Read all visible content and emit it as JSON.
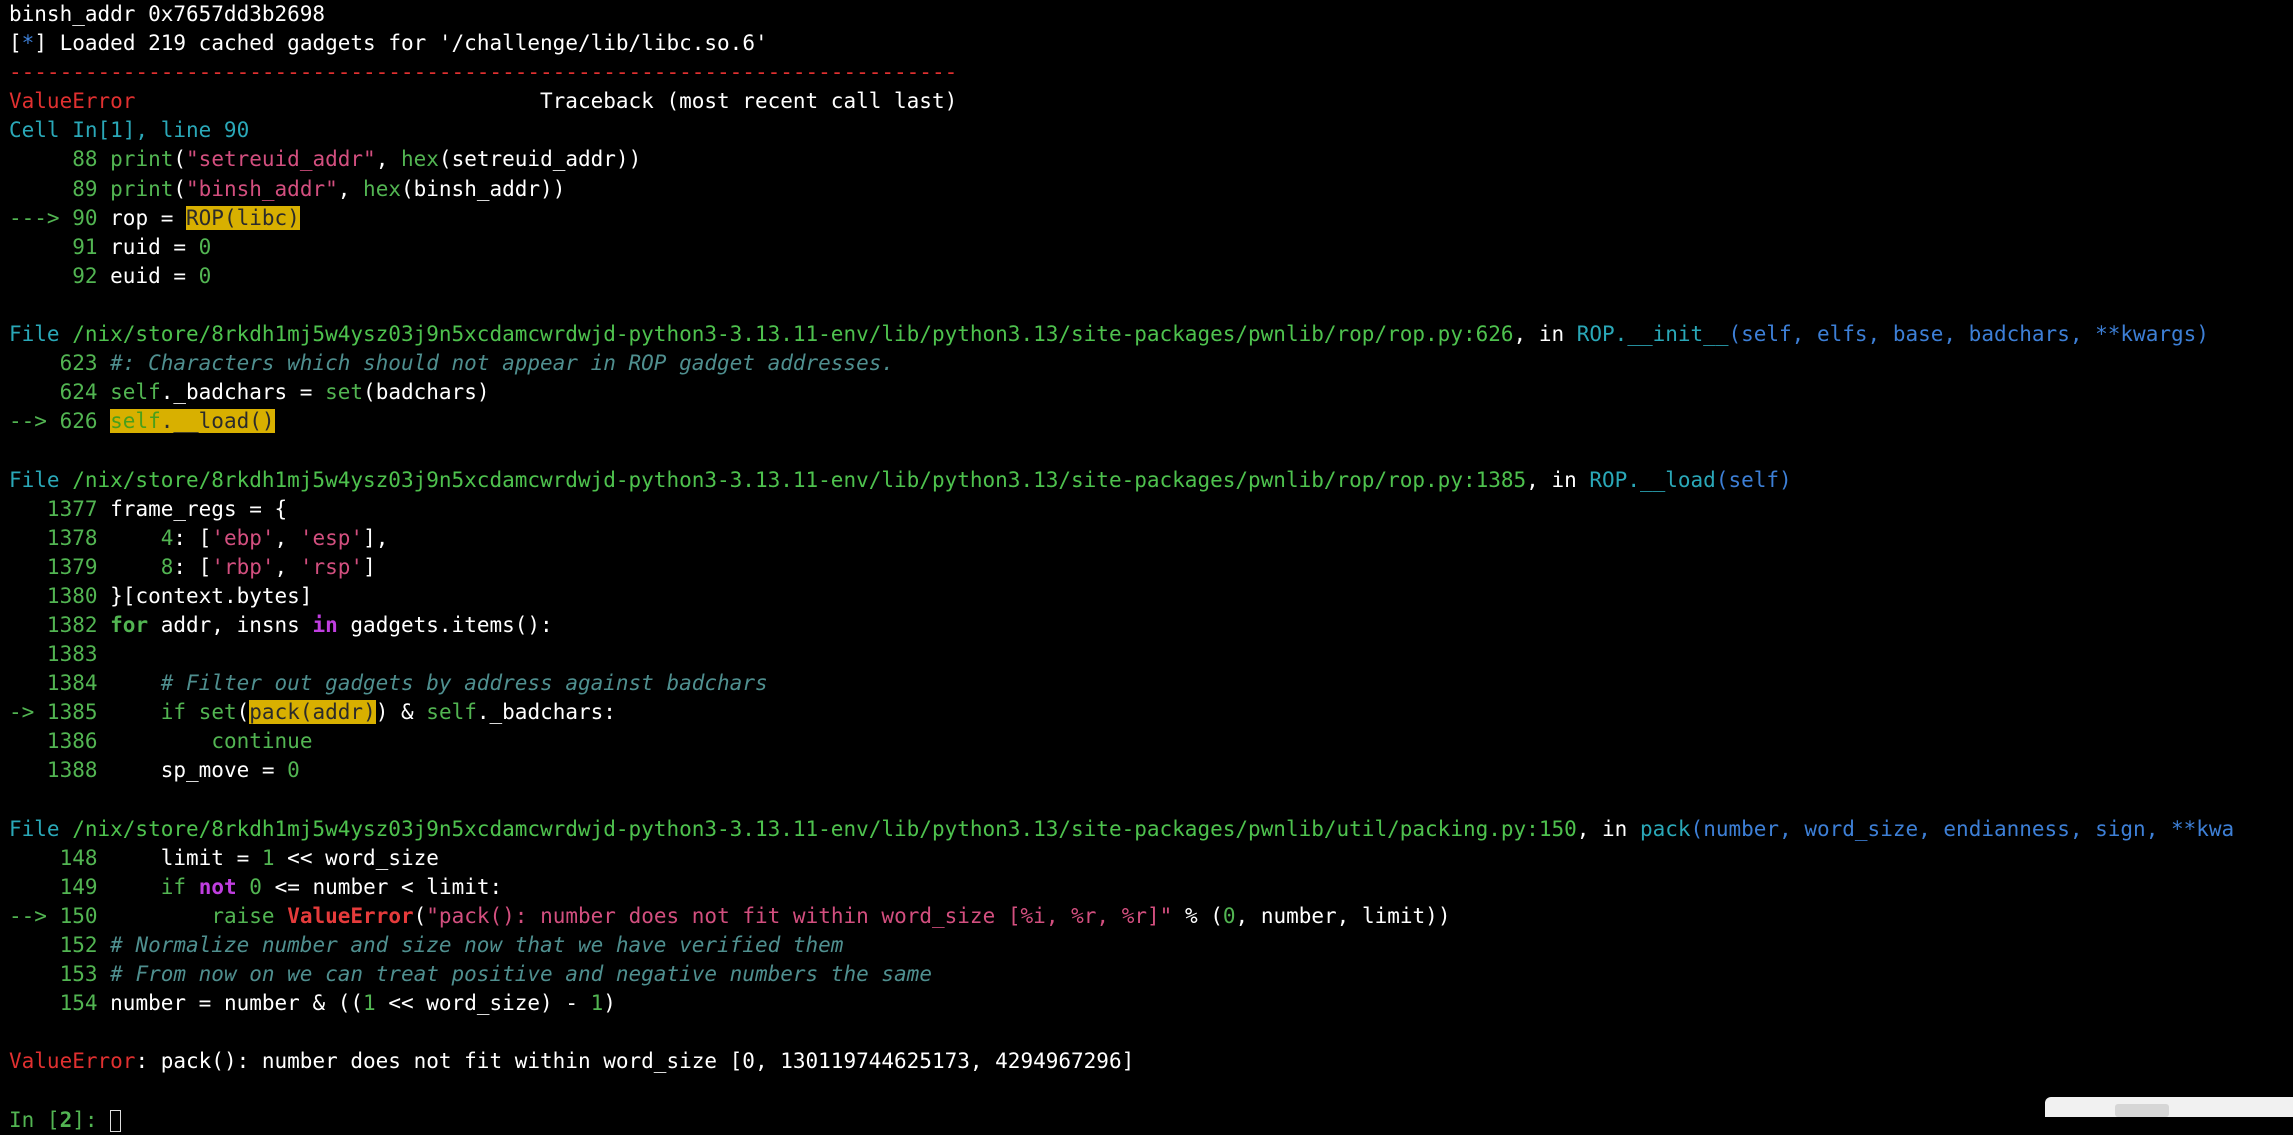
{
  "terminal": {
    "lines": [
      [
        {
          "t": "binsh_addr 0x7657dd3b2698"
        }
      ],
      [
        {
          "t": "[",
          "c": ""
        },
        {
          "t": "*",
          "c": "t-blue"
        },
        {
          "t": "] Loaded 219 cached gadgets for '/challenge/lib/libc.so.6'"
        }
      ],
      [
        {
          "t": "---------------------------------------------------------------------------",
          "c": "t-red"
        }
      ],
      [
        {
          "t": "ValueError",
          "c": "t-red"
        },
        {
          "t": "                                Traceback (most recent call last)"
        }
      ],
      [
        {
          "t": "Cell ",
          "c": "t-cyan"
        },
        {
          "t": "In[1], line 90",
          "c": "t-cyan"
        }
      ],
      [
        {
          "t": "     88 ",
          "c": "t-dgreen"
        },
        {
          "t": "print",
          "c": "t-dgreen"
        },
        {
          "t": "("
        },
        {
          "t": "\"setreuid_addr\"",
          "c": "t-str"
        },
        {
          "t": ", "
        },
        {
          "t": "hex",
          "c": "t-dgreen"
        },
        {
          "t": "(setreuid_addr))"
        }
      ],
      [
        {
          "t": "     89 ",
          "c": "t-dgreen"
        },
        {
          "t": "print",
          "c": "t-dgreen"
        },
        {
          "t": "("
        },
        {
          "t": "\"binsh_addr\"",
          "c": "t-str"
        },
        {
          "t": ", "
        },
        {
          "t": "hex",
          "c": "t-dgreen"
        },
        {
          "t": "(binsh_addr))"
        }
      ],
      [
        {
          "t": "---> 90 ",
          "c": "t-dgreen"
        },
        {
          "t": "rop = "
        },
        {
          "t": "ROP(libc)",
          "c": "t-hl"
        }
      ],
      [
        {
          "t": "     91 ",
          "c": "t-dgreen"
        },
        {
          "t": "ruid = "
        },
        {
          "t": "0",
          "c": "t-dgreen"
        }
      ],
      [
        {
          "t": "     92 ",
          "c": "t-dgreen"
        },
        {
          "t": "euid = "
        },
        {
          "t": "0",
          "c": "t-dgreen"
        }
      ],
      [
        {
          "t": ""
        }
      ],
      [
        {
          "t": "File ",
          "c": "t-cyan"
        },
        {
          "t": "/nix/store/8rkdh1mj5w4ysz03j9n5xcdamcwrdwjd-python3-3.13.11-env/lib/python3.13/site-packages/pwnlib/rop/rop.py:626",
          "c": "t-green"
        },
        {
          "t": ", in "
        },
        {
          "t": "ROP.__init__",
          "c": "t-cyan"
        },
        {
          "t": "(self, elfs, base, badchars, **kwargs)",
          "c": "t-blue"
        }
      ],
      [
        {
          "t": "    623 ",
          "c": "t-dgreen"
        },
        {
          "t": "#: Characters which should not appear in ROP gadget addresses.",
          "c": "t-comment"
        }
      ],
      [
        {
          "t": "    624 ",
          "c": "t-dgreen"
        },
        {
          "t": "self",
          "c": "t-dgreen"
        },
        {
          "t": "._badchars = "
        },
        {
          "t": "set",
          "c": "t-dgreen"
        },
        {
          "t": "(badchars)"
        }
      ],
      [
        {
          "t": "--> 626 ",
          "c": "t-dgreen"
        },
        {
          "t": "self",
          "c": "t-hlg"
        },
        {
          "t": ".__load()",
          "c": "t-hl"
        }
      ],
      [
        {
          "t": ""
        }
      ],
      [
        {
          "t": "File ",
          "c": "t-cyan"
        },
        {
          "t": "/nix/store/8rkdh1mj5w4ysz03j9n5xcdamcwrdwjd-python3-3.13.11-env/lib/python3.13/site-packages/pwnlib/rop/rop.py:1385",
          "c": "t-green"
        },
        {
          "t": ", in "
        },
        {
          "t": "ROP.__load",
          "c": "t-cyan"
        },
        {
          "t": "(self)",
          "c": "t-blue"
        }
      ],
      [
        {
          "t": "   1377 ",
          "c": "t-dgreen"
        },
        {
          "t": "frame_regs = {"
        }
      ],
      [
        {
          "t": "   1378 ",
          "c": "t-dgreen"
        },
        {
          "t": "    "
        },
        {
          "t": "4",
          "c": "t-dgreen"
        },
        {
          "t": ": ["
        },
        {
          "t": "'ebp'",
          "c": "t-str"
        },
        {
          "t": ", "
        },
        {
          "t": "'esp'",
          "c": "t-str"
        },
        {
          "t": "],"
        }
      ],
      [
        {
          "t": "   1379 ",
          "c": "t-dgreen"
        },
        {
          "t": "    "
        },
        {
          "t": "8",
          "c": "t-dgreen"
        },
        {
          "t": ": ["
        },
        {
          "t": "'rbp'",
          "c": "t-str"
        },
        {
          "t": ", "
        },
        {
          "t": "'rsp'",
          "c": "t-str"
        },
        {
          "t": "]"
        }
      ],
      [
        {
          "t": "   1380 ",
          "c": "t-dgreen"
        },
        {
          "t": "}[context.bytes]"
        }
      ],
      [
        {
          "t": "   1382 ",
          "c": "t-dgreen"
        },
        {
          "t": "for",
          "c": "t-dgreen t-bold"
        },
        {
          "t": " addr, insns "
        },
        {
          "t": "in",
          "c": "t-purple"
        },
        {
          "t": " gadgets.items():"
        }
      ],
      [
        {
          "t": "   1383 ",
          "c": "t-dgreen"
        }
      ],
      [
        {
          "t": "   1384 ",
          "c": "t-dgreen"
        },
        {
          "t": "    "
        },
        {
          "t": "# Filter out gadgets by address against badchars",
          "c": "t-comment"
        }
      ],
      [
        {
          "t": "-> 1385 ",
          "c": "t-dgreen"
        },
        {
          "t": "    "
        },
        {
          "t": "if",
          "c": "t-dgreen"
        },
        {
          "t": " "
        },
        {
          "t": "set",
          "c": "t-dgreen"
        },
        {
          "t": "("
        },
        {
          "t": "pack(addr)",
          "c": "t-hl"
        },
        {
          "t": ") & "
        },
        {
          "t": "self",
          "c": "t-dgreen"
        },
        {
          "t": "._badchars:"
        }
      ],
      [
        {
          "t": "   1386 ",
          "c": "t-dgreen"
        },
        {
          "t": "        "
        },
        {
          "t": "continue",
          "c": "t-dgreen"
        }
      ],
      [
        {
          "t": "   1388 ",
          "c": "t-dgreen"
        },
        {
          "t": "    sp_move = "
        },
        {
          "t": "0",
          "c": "t-dgreen"
        }
      ],
      [
        {
          "t": ""
        }
      ],
      [
        {
          "t": "File ",
          "c": "t-cyan"
        },
        {
          "t": "/nix/store/8rkdh1mj5w4ysz03j9n5xcdamcwrdwjd-python3-3.13.11-env/lib/python3.13/site-packages/pwnlib/util/packing.py:150",
          "c": "t-green"
        },
        {
          "t": ", in "
        },
        {
          "t": "pack",
          "c": "t-cyan"
        },
        {
          "t": "(number, word_size, endianness, sign, **kwa",
          "c": "t-blue"
        }
      ],
      [
        {
          "t": "    148 ",
          "c": "t-dgreen"
        },
        {
          "t": "    limit = "
        },
        {
          "t": "1",
          "c": "t-dgreen"
        },
        {
          "t": " << word_size"
        }
      ],
      [
        {
          "t": "    149 ",
          "c": "t-dgreen"
        },
        {
          "t": "    "
        },
        {
          "t": "if",
          "c": "t-dgreen"
        },
        {
          "t": " "
        },
        {
          "t": "not",
          "c": "t-purple"
        },
        {
          "t": " "
        },
        {
          "t": "0",
          "c": "t-dgreen"
        },
        {
          "t": " <= number < limit:"
        }
      ],
      [
        {
          "t": "--> 150 ",
          "c": "t-dgreen"
        },
        {
          "t": "        "
        },
        {
          "t": "raise",
          "c": "t-dgreen"
        },
        {
          "t": " "
        },
        {
          "t": "ValueError",
          "c": "t-bred"
        },
        {
          "t": "("
        },
        {
          "t": "\"pack(): number does not fit within word_size [",
          "c": "t-str"
        },
        {
          "t": "%i",
          "c": "t-str"
        },
        {
          "t": ", ",
          "c": "t-str"
        },
        {
          "t": "%r",
          "c": "t-str"
        },
        {
          "t": ", ",
          "c": "t-str"
        },
        {
          "t": "%r",
          "c": "t-str"
        },
        {
          "t": "]\"",
          "c": "t-str"
        },
        {
          "t": " % ("
        },
        {
          "t": "0",
          "c": "t-dgreen"
        },
        {
          "t": ", number, limit))"
        }
      ],
      [
        {
          "t": "    152 ",
          "c": "t-dgreen"
        },
        {
          "t": "# Normalize number and size now that we have verified them",
          "c": "t-comment"
        }
      ],
      [
        {
          "t": "    153 ",
          "c": "t-dgreen"
        },
        {
          "t": "# From now on we can treat positive and negative numbers the same",
          "c": "t-comment"
        }
      ],
      [
        {
          "t": "    154 ",
          "c": "t-dgreen"
        },
        {
          "t": "number = number & (("
        },
        {
          "t": "1",
          "c": "t-dgreen"
        },
        {
          "t": " << word_size) - "
        },
        {
          "t": "1",
          "c": "t-dgreen"
        },
        {
          "t": ")"
        }
      ],
      [
        {
          "t": ""
        }
      ],
      [
        {
          "t": "ValueError",
          "c": "t-red"
        },
        {
          "t": ": pack(): number does not fit within word_size [0, 130119744625173, 4294967296]"
        }
      ],
      [
        {
          "t": ""
        }
      ],
      [
        {
          "t": "In [",
          "c": "t-dgreen"
        },
        {
          "t": "2",
          "c": "t-dgreen t-bold"
        },
        {
          "t": "]: ",
          "c": "t-dgreen"
        }
      ]
    ]
  }
}
